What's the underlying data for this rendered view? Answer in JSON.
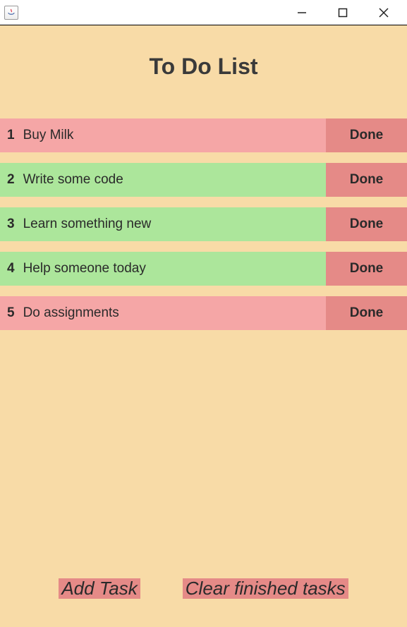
{
  "window": {
    "title": ""
  },
  "app": {
    "title": "To Do List"
  },
  "tasks": [
    {
      "index": "1",
      "text": "Buy Milk",
      "done_label": "Done",
      "color": "pink"
    },
    {
      "index": "2",
      "text": "Write some code",
      "done_label": "Done",
      "color": "green"
    },
    {
      "index": "3",
      "text": "Learn something new",
      "done_label": "Done",
      "color": "green"
    },
    {
      "index": "4",
      "text": "Help someone today",
      "done_label": "Done",
      "color": "green"
    },
    {
      "index": "5",
      "text": "Do assignments",
      "done_label": "Done",
      "color": "pink"
    }
  ],
  "footer": {
    "add_label": "Add Task",
    "clear_label": "Clear finished tasks"
  }
}
